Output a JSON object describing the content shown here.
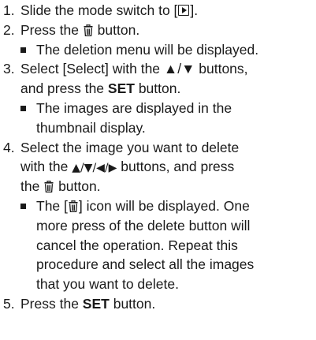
{
  "lines": [
    {
      "num": "1.",
      "text_before": "Slide the mode switch to [",
      "text_after": "]."
    },
    {
      "num": "2.",
      "text_before": "Press the ",
      "text_after": " button."
    },
    {
      "bullet_text": "The deletion menu will be displayed."
    },
    {
      "num": "3.",
      "text": "Select [Select] with the ▲/▼ buttons,"
    },
    {
      "text_before": "and press the ",
      "bold": "SET",
      "text_after": " button."
    },
    {
      "bullet_text": "The images are displayed in the"
    },
    {
      "text": "thumbnail display."
    },
    {
      "num": "4.",
      "text": "Select the image you want to delete"
    },
    {
      "text_before": "with the ",
      "arrows": "▲/▼/◀/▶",
      "text_after": " buttons, and press"
    },
    {
      "text_before": "the ",
      "text_after": " button."
    },
    {
      "bullet_text_before": "The [",
      "bullet_text_after": "] icon will be displayed. One"
    },
    {
      "text": "more press of the delete button will"
    },
    {
      "text": "cancel the operation. Repeat this"
    },
    {
      "text": "procedure and select all the images"
    },
    {
      "text": "that you want to delete."
    },
    {
      "num": "5.",
      "text_before": "Press the ",
      "bold": "SET",
      "text_after": " button."
    }
  ],
  "icons": {
    "playback": "playback-mode-icon",
    "delete": "trash-icon"
  }
}
